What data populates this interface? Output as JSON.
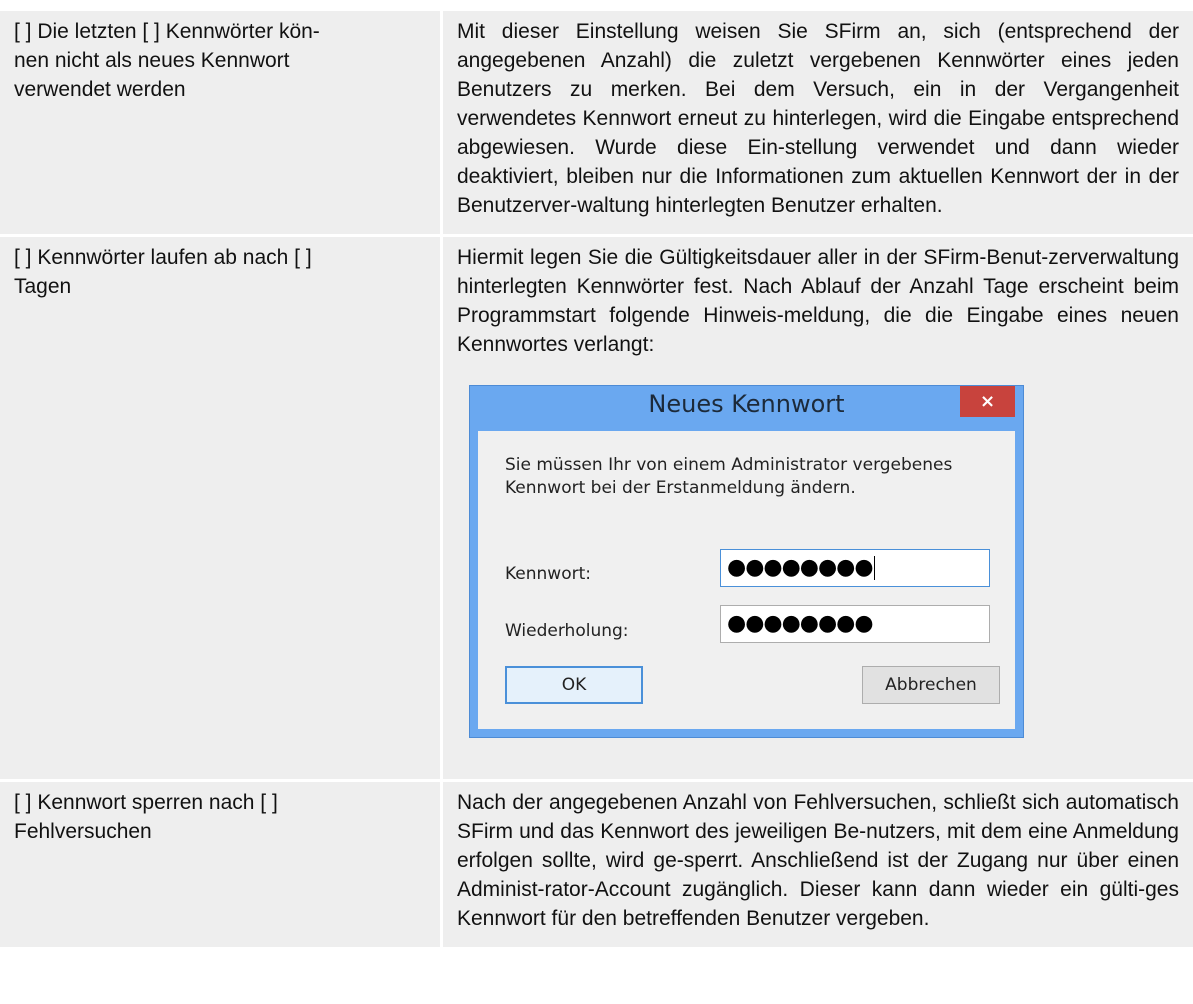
{
  "rows": [
    {
      "setting": "[ ] Die letzten [ ] Kennwörter kön-\nnen nicht als neues Kennwort\nverwendet werden",
      "description": "Mit dieser Einstellung weisen Sie SFirm an, sich (entsprechend der angegebenen Anzahl) die zuletzt vergebenen Kennwörter eines jeden Benutzers zu merken. Bei dem Versuch, ein in der Vergangenheit verwendetes Kennwort erneut zu hinterlegen, wird die Eingabe entsprechend abgewiesen. Wurde diese Ein-stellung verwendet und dann wieder deaktiviert, bleiben nur die Informationen zum aktuellen Kennwort der in der Benutzerver-waltung hinterlegten Benutzer erhalten."
    },
    {
      "setting": "[ ] Kennwörter laufen ab nach [ ]\nTagen",
      "description": "Hiermit legen Sie die Gültigkeitsdauer aller in der SFirm-Benut-zerverwaltung hinterlegten Kennwörter fest. Nach Ablauf der Anzahl Tage erscheint beim Programmstart folgende Hinweis-meldung, die die Eingabe eines neuen Kennwortes verlangt:"
    },
    {
      "setting": "[ ] Kennwort sperren nach [ ]\nFehlversuchen",
      "description": "Nach der angegebenen Anzahl von Fehlversuchen, schließt sich automatisch SFirm und das Kennwort des jeweiligen Be-nutzers, mit dem eine Anmeldung erfolgen sollte, wird ge-sperrt. Anschließend ist der Zugang nur über einen Administ-rator-Account zugänglich. Dieser kann dann wieder ein gülti-ges Kennwort für den betreffenden Benutzer vergeben."
    }
  ],
  "dialog": {
    "title": "Neues Kennwort",
    "close_glyph": "×",
    "message": "Sie müssen Ihr von einem Administrator vergebenes\nKennwort bei der Erstanmeldung ändern.",
    "password_label": "Kennwort:",
    "password_value": "●●●●●●●●",
    "repeat_label": "Wiederholung:",
    "repeat_value": "●●●●●●●●",
    "ok_label": "OK",
    "cancel_label": "Abbrechen"
  }
}
